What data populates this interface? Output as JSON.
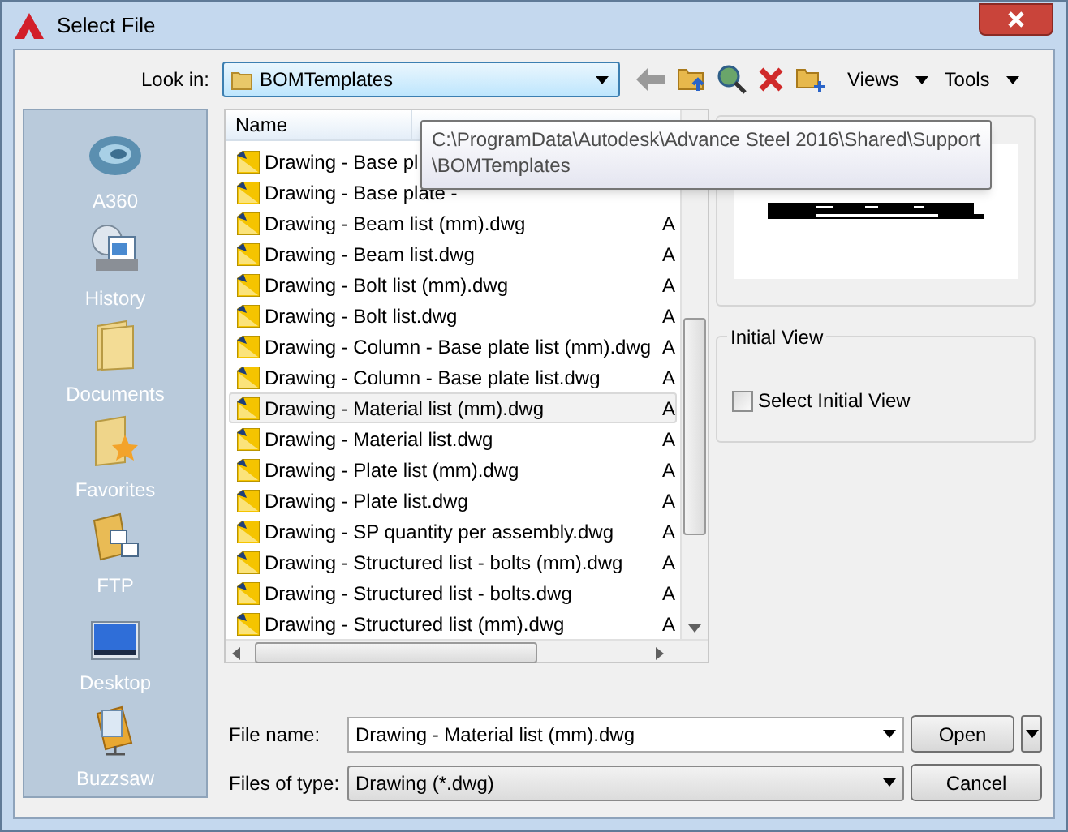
{
  "window": {
    "title": "Select File"
  },
  "look_in": {
    "label": "Look in:",
    "value": "BOMTemplates"
  },
  "toolbar": {
    "menus": [
      {
        "label": "Views"
      },
      {
        "label": "Tools"
      }
    ]
  },
  "places": [
    {
      "label": "A360",
      "kind": "cloud"
    },
    {
      "label": "History",
      "kind": "history"
    },
    {
      "label": "Documents",
      "kind": "documents"
    },
    {
      "label": "Favorites",
      "kind": "favorites"
    },
    {
      "label": "FTP",
      "kind": "ftp"
    },
    {
      "label": "Desktop",
      "kind": "desktop"
    },
    {
      "label": "Buzzsaw",
      "kind": "buzzsaw"
    }
  ],
  "file_list": {
    "columns": [
      {
        "label": "Name"
      }
    ],
    "rows": [
      {
        "name": "Drawing - Base pl",
        "selected": false
      },
      {
        "name": "Drawing - Base plate -",
        "selected": false
      },
      {
        "name": "Drawing - Beam list (mm).dwg",
        "column_2": "A",
        "selected": false
      },
      {
        "name": "Drawing - Beam list.dwg",
        "column_2": "A",
        "selected": false
      },
      {
        "name": "Drawing - Bolt list (mm).dwg",
        "column_2": "A",
        "selected": false
      },
      {
        "name": "Drawing - Bolt list.dwg",
        "column_2": "A",
        "selected": false
      },
      {
        "name": "Drawing - Column - Base plate list (mm).dwg",
        "column_2": "A",
        "selected": false
      },
      {
        "name": "Drawing - Column - Base plate list.dwg",
        "column_2": "A",
        "selected": false
      },
      {
        "name": "Drawing - Material list (mm).dwg",
        "column_2": "A",
        "selected": true
      },
      {
        "name": "Drawing - Material list.dwg",
        "column_2": "A",
        "selected": false
      },
      {
        "name": "Drawing - Plate list (mm).dwg",
        "column_2": "A",
        "selected": false
      },
      {
        "name": "Drawing - Plate list.dwg",
        "column_2": "A",
        "selected": false
      },
      {
        "name": "Drawing - SP quantity per assembly.dwg",
        "column_2": "A",
        "selected": false
      },
      {
        "name": "Drawing - Structured list - bolts (mm).dwg",
        "column_2": "A",
        "selected": false
      },
      {
        "name": "Drawing - Structured list - bolts.dwg",
        "column_2": "A",
        "selected": false
      },
      {
        "name": "Drawing - Structured list (mm).dwg",
        "column_2": "A",
        "selected": false
      }
    ]
  },
  "tooltip": {
    "lines": [
      "C:\\ProgramData\\Autodesk\\Advance Steel 2016\\Shared\\Support",
      "\\BOMTemplates"
    ]
  },
  "initial_view": {
    "title": "Initial View",
    "checkbox": {
      "label": "Select Initial View",
      "checked": false
    }
  },
  "file_name": {
    "label": "File name:",
    "value": "Drawing - Material list (mm).dwg"
  },
  "file_type": {
    "label": "Files of type:",
    "value": "Drawing (*.dwg)"
  },
  "buttons": [
    {
      "label": "Open",
      "kind": "split"
    },
    {
      "label": "Cancel",
      "kind": "plain"
    }
  ]
}
